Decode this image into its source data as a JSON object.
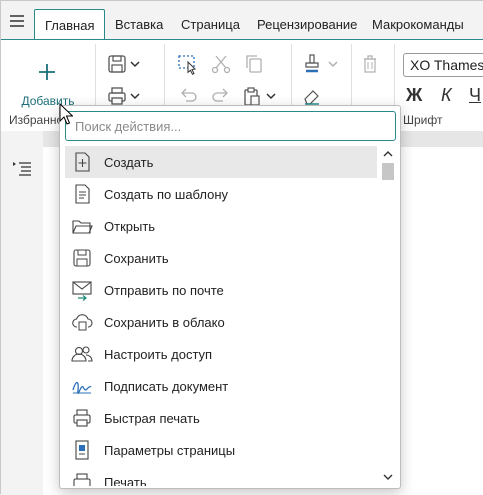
{
  "tabs": [
    {
      "label": "Главная",
      "active": true
    },
    {
      "label": "Вставка"
    },
    {
      "label": "Страница"
    },
    {
      "label": "Рецензирование"
    },
    {
      "label": "Макрокоманды"
    }
  ],
  "ribbon": {
    "add_label": "Добавить",
    "favorites_label": "Избранное",
    "font_group_label": "Шрифт",
    "font_name": "XO Thames",
    "format_buttons": [
      "Ж",
      "К",
      "Ч"
    ]
  },
  "search": {
    "placeholder": "Поиск действия...",
    "value": ""
  },
  "actions": [
    {
      "label": "Создать",
      "icon": "new-document-icon",
      "highlighted": true
    },
    {
      "label": "Создать по шаблону",
      "icon": "template-document-icon"
    },
    {
      "label": "Открыть",
      "icon": "folder-open-icon"
    },
    {
      "label": "Сохранить",
      "icon": "save-icon"
    },
    {
      "label": "Отправить по почте",
      "icon": "mail-send-icon"
    },
    {
      "label": "Сохранить в облако",
      "icon": "cloud-save-icon"
    },
    {
      "label": "Настроить доступ",
      "icon": "users-access-icon"
    },
    {
      "label": "Подписать документ",
      "icon": "signature-icon"
    },
    {
      "label": "Быстрая печать",
      "icon": "quick-print-icon"
    },
    {
      "label": "Параметры страницы",
      "icon": "page-setup-icon"
    },
    {
      "label": "Печать",
      "icon": "print-icon"
    }
  ],
  "colors": {
    "accent": "#2a8a8a",
    "highlight": "#e8e8e8"
  }
}
